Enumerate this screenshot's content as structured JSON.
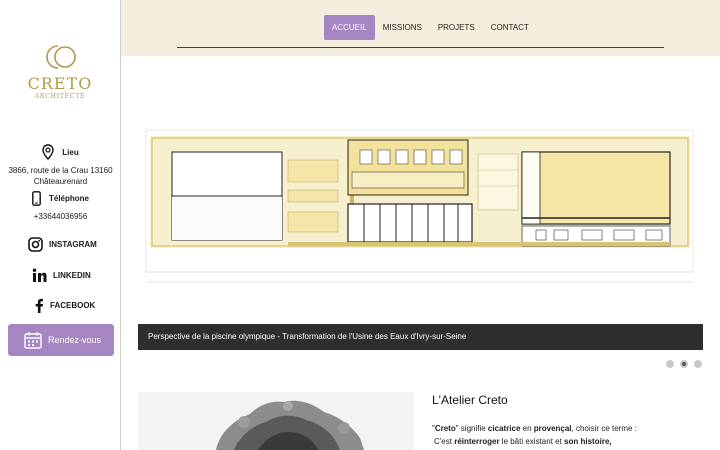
{
  "brand": {
    "name": "CRETO",
    "subtitle": "ARCHITECTE",
    "accent_color": "#a586c2",
    "gold_color": "#b09a4c"
  },
  "sidebar": {
    "lieu_label": "Lieu",
    "address_line1": "3866, route de la Crau 13160",
    "address_line2": "Châteaurenard",
    "phone_label": "Téléphone",
    "phone": "+33644036956",
    "instagram": "INSTAGRAM",
    "linkedin": "LINKEDIN",
    "facebook": "FACEBOOK",
    "rdv_button": "Rendez-vous"
  },
  "nav": {
    "items": [
      "ACCUEIL",
      "MISSIONS",
      "PROJETS",
      "CONTACT"
    ],
    "active": "ACCUEIL"
  },
  "slider": {
    "caption": "Perspective de la piscine olympique - Transformation de l'Usine des Eaux d'Ivry-sur-Seine",
    "slide_count": 3,
    "active_slide": 2
  },
  "atelier": {
    "title": "L'Atelier Creto",
    "p1_q_open": "\"",
    "p1_b1": "Creto",
    "p1_t1": "\" signifie ",
    "p1_b2": "cicatrice",
    "p1_t2": " en ",
    "p1_b3": "provençal",
    "p1_t3": ", choisir ce terme :",
    "p2_t1": "C'est ",
    "p2_b1": "réinterroger",
    "p2_t2": " le bâti existant et ",
    "p2_b2": "son histoire,"
  }
}
